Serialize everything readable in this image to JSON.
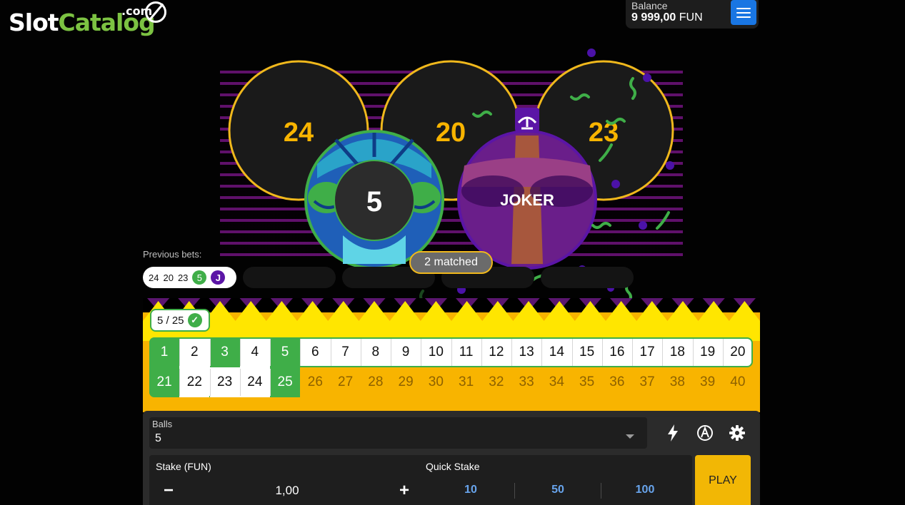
{
  "logo": {
    "slot": "Slot",
    "catalog": "Catalog",
    "com": ".com"
  },
  "balance": {
    "label": "Balance",
    "amount": "9 999,00",
    "currency": "FUN"
  },
  "draw": {
    "numbers": [
      "24",
      "20",
      "23"
    ],
    "ball_number": "5",
    "joker_label": "JOKER",
    "matched_text": "2 matched"
  },
  "previous_bets": {
    "label": "Previous bets:",
    "numbers": [
      "24",
      "20",
      "23"
    ],
    "ball": "5",
    "joker": "J"
  },
  "board": {
    "counter": "5 / 25",
    "row1": [
      "1",
      "2",
      "3",
      "4",
      "5",
      "6",
      "7",
      "8",
      "9",
      "10",
      "11",
      "12",
      "13",
      "14",
      "15",
      "16",
      "17",
      "18",
      "19",
      "20"
    ],
    "row2": [
      "21",
      "22",
      "23",
      "24",
      "25",
      "26",
      "27",
      "28",
      "29",
      "30",
      "31",
      "32",
      "33",
      "34",
      "35",
      "36",
      "37",
      "38",
      "39",
      "40"
    ],
    "selected": [
      "1",
      "3",
      "5",
      "21",
      "25"
    ]
  },
  "controls": {
    "balls_label": "Balls",
    "balls_value": "5",
    "stake_label": "Stake (FUN)",
    "stake_value": "1,00",
    "minus": "−",
    "plus": "+",
    "quick_label": "Quick Stake",
    "quick_values": [
      "10",
      "50",
      "100"
    ],
    "play_label": "PLAY"
  },
  "icons": [
    "lightning-icon",
    "auto-play-icon",
    "gear-icon",
    "menu-icon",
    "check-icon",
    "jester-hat-icon"
  ],
  "colors": {
    "accent_yellow": "#f8b400",
    "green": "#3fae48",
    "purple": "#5b15a6",
    "blue": "#1976e3",
    "ring_gold": "#f0b81c"
  }
}
